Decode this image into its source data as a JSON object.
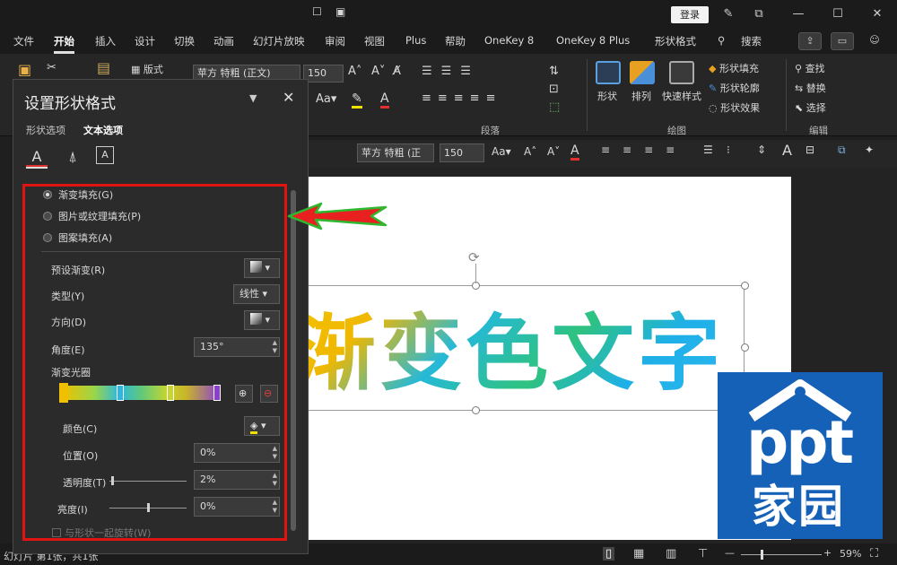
{
  "titlebar": {
    "login_label": "登录",
    "icons": [
      "pen-icon",
      "restore-icon",
      "minimize-icon",
      "maximize-icon",
      "close-icon"
    ]
  },
  "menu": {
    "tabs": [
      "文件",
      "开始",
      "插入",
      "设计",
      "切换",
      "动画",
      "幻灯片放映",
      "审阅",
      "视图",
      "Plus",
      "帮助",
      "OneKey 8",
      "OneKey 8 Plus",
      "形状格式"
    ],
    "active_tab": "开始",
    "search_label": "搜索"
  },
  "ribbon": {
    "style_label": "版式",
    "font_name": "苹方 特粗 (正文)",
    "font_size": "150",
    "paragraph_label": "段落",
    "drawing_label": "绘图",
    "editing_label": "编辑",
    "shape_label": "形状",
    "arrange_label": "排列",
    "quick_style_label": "快速样式",
    "shape_fill_label": "形状填充",
    "shape_outline_label": "形状轮廓",
    "shape_effects_label": "形状效果",
    "find_label": "查找",
    "replace_label": "替换",
    "select_label": "选择"
  },
  "minitoolbar": {
    "font_name": "苹方 特粗 (正",
    "font_size": "150"
  },
  "slide": {
    "text": "渐变色文字",
    "logo_top": "ppt",
    "logo_bottom": "家园",
    "logo_color": "#1661b8"
  },
  "pane": {
    "title": "设置形状格式",
    "tab_shape": "形状选项",
    "tab_text": "文本选项",
    "fill_options": [
      "渐变填充(G)",
      "图片或纹理填充(P)",
      "图案填充(A)"
    ],
    "preset_label": "预设渐变(R)",
    "type_label": "类型(Y)",
    "type_value": "线性",
    "direction_label": "方向(D)",
    "angle_label": "角度(E)",
    "angle_value": "135°",
    "stops_label": "渐变光圈",
    "color_label": "颜色(C)",
    "position_label": "位置(O)",
    "position_value": "0%",
    "transparency_label": "透明度(T)",
    "transparency_value": "2%",
    "brightness_label": "亮度(I)",
    "brightness_value": "0%",
    "rotate_label": "与形状一起旋转(W)"
  },
  "statusbar": {
    "slide_info": "幻灯片 第1张，共1张",
    "zoom": "59%"
  },
  "colors": {
    "highlight": "#e21313",
    "arrow_fill": "#e82020",
    "arrow_outline": "#2eb82e"
  }
}
